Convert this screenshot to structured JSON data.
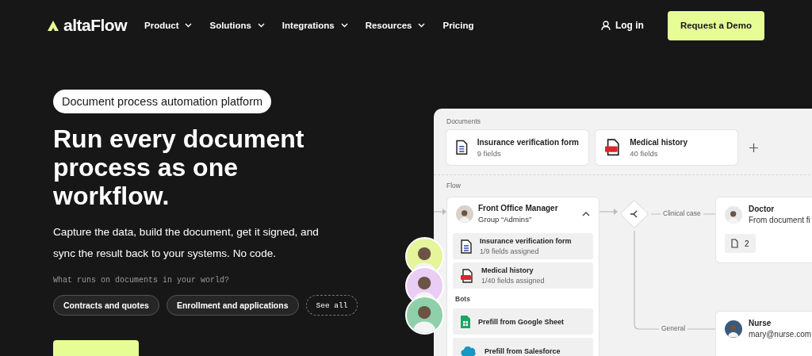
{
  "nav": {
    "logo": "altaFlow",
    "items": [
      {
        "label": "Product",
        "has_menu": true
      },
      {
        "label": "Solutions",
        "has_menu": true
      },
      {
        "label": "Integrations",
        "has_menu": true
      },
      {
        "label": "Resources",
        "has_menu": true
      },
      {
        "label": "Pricing",
        "has_menu": false
      }
    ],
    "login": "Log in",
    "cta": "Request a Demo"
  },
  "hero": {
    "badge": "Document process automation platform",
    "headline": "Run every document process as one workflow.",
    "description": "Capture the data, build the document, get it signed, and sync the result back to your systems. No code.",
    "prompt": "What runs on documents in your world?",
    "chips": [
      {
        "label": "Contracts and quotes",
        "kind": "chip"
      },
      {
        "label": "Enrollment and applications",
        "kind": "chip"
      },
      {
        "label": "See all",
        "kind": "more"
      }
    ]
  },
  "panel": {
    "documents_label": "Documents",
    "documents": [
      {
        "title": "Insurance verification form",
        "subtitle": "9 fields",
        "kind": "form"
      },
      {
        "title": "Medical history",
        "subtitle": "40 fields",
        "kind": "pdf"
      }
    ],
    "flow_label": "Flow",
    "node": {
      "title": "Front Office Manager",
      "subtitle": "Group “Admins”",
      "expanded": true,
      "items": [
        {
          "title": "Insurance verification form",
          "subtitle": "1/9 fields assigned",
          "kind": "form"
        },
        {
          "title": "Medical history",
          "subtitle": "1/40 fields assigned",
          "kind": "pdf"
        }
      ],
      "bots_label": "Bots",
      "bots": [
        {
          "label": "Prefill from Google Sheet",
          "kind": "sheets"
        },
        {
          "label": "Prefill from Salesforce",
          "kind": "salesforce"
        }
      ]
    },
    "branches": [
      {
        "label": "Clinical case"
      },
      {
        "label": "General"
      }
    ],
    "recipients": [
      {
        "name": "Doctor",
        "detail": "From document fi",
        "count": "2"
      },
      {
        "name": "Nurse",
        "detail": "mary@nurse.com"
      }
    ]
  }
}
